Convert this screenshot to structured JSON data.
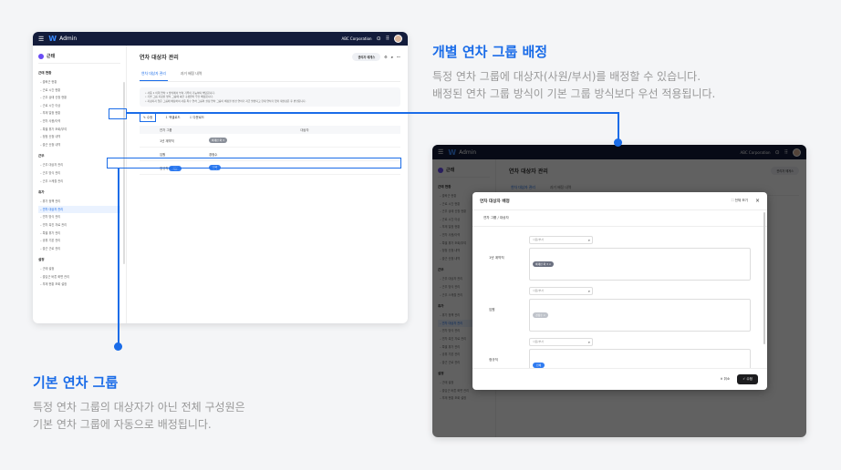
{
  "app": {
    "title": "Admin",
    "company": "ABC Corporation",
    "brand": "근태"
  },
  "sidebar": {
    "sections": [
      {
        "label": "근태 현황",
        "items": [
          "출퇴근 현황",
          "근로 시간 현황",
          "근무 상태 신청 현황",
          "근로 시간 이상",
          "부재 일정 현황",
          "연차 사용/이력",
          "특별 휴가 조회/부여",
          "정정 신청 내역",
          "출근 신청 내역"
        ]
      },
      {
        "label": "근무",
        "items": [
          "근무 대상자 관리",
          "근무 방식 관리",
          "근무 스케줄 관리"
        ]
      },
      {
        "label": "휴가",
        "items": [
          "휴가 정책 관리",
          "연차 대상자 관리",
          "연차 방식 관리",
          "연차 촉진 자료 관리",
          "특별 휴가 관리",
          "공휴 기본 관리",
          "출근 근로 관리"
        ]
      },
      {
        "label": "설정",
        "items": [
          "근태 설정",
          "출입근 버튼 화면 관리",
          "부재 현황 조회 설정"
        ]
      }
    ],
    "active": "연차 대상자 관리"
  },
  "main": {
    "title": "연차 대상자 관리",
    "header_pill": "관리자 에게스",
    "tabs": [
      "연차 대상자 관리",
      "과거 배정 내역"
    ],
    "notice": [
      "• 사용 1 이력 연차 1 방식에서 부여 기록이 가능하며 해당됩니다.",
      "• 기본 그룹 지정된 방식 그룹에 속한 구성원이 우선 배정됩니다.",
      "• 지정되지 않은 그룹에 배정하여 사용 특수 연차 그룹의 설정 연차 그룹이 배정을 변경 연차가 지급 발생되고 현재 연차가 있어 재설정은 후 변경됩니다."
    ],
    "actions": {
      "edit": "수정",
      "excel": "엑셀로드",
      "download": "다운로드"
    },
    "table": {
      "headers": [
        "연차 그룹",
        "대상자"
      ],
      "rows": [
        {
          "group": "1년 계약직",
          "target": "박재민 외 3"
        },
        {
          "group": "임원",
          "target": "경정수"
        },
        {
          "group": "정규직",
          "target": "전체"
        }
      ],
      "default_badge": "기본"
    }
  },
  "modal": {
    "title": "연차 대상자 배정",
    "view_all": "전체 보기",
    "subheader": "연차 그룹 / 대상자",
    "search_placeholder": "사원/부서",
    "groups": [
      {
        "label": "1년 계약직",
        "chip": "박재민 외 3"
      },
      {
        "label": "임원",
        "chip": "경정수"
      },
      {
        "label": "정규직",
        "chip": "전체"
      }
    ],
    "cancel": "취소",
    "save": "수정"
  },
  "callouts": {
    "right": {
      "title": "개별 연차 그룹 배정",
      "lines": [
        "특정 연차 그룹에 대상자(사원/부서)를 배정할 수 있습니다.",
        "배정된 연차 그룹 방식이 기본 그룹 방식보다 우선 적용됩니다."
      ]
    },
    "left": {
      "title": "기본 연차 그룹",
      "lines": [
        "특정 연차 그룹의 대상자가 아닌 전체 구성원은",
        "기본 연차 그룹에 자동으로 배정됩니다."
      ]
    }
  },
  "colors": {
    "accent": "#1a6ce8",
    "topbar": "#131c3b"
  }
}
